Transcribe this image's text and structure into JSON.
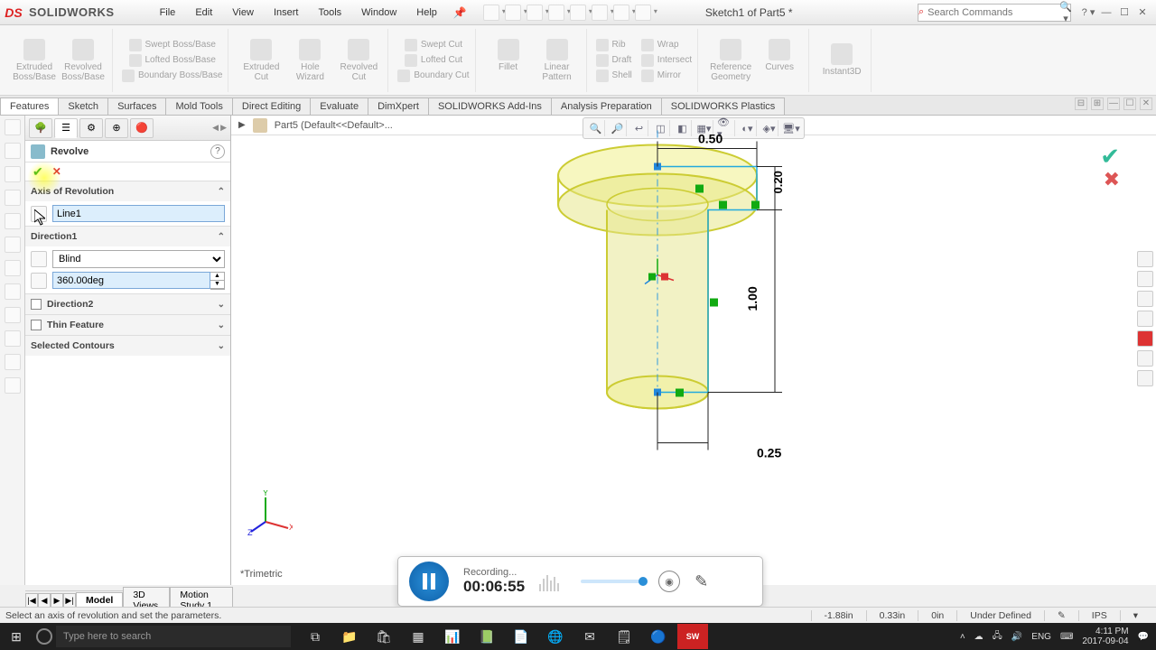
{
  "brand": {
    "prefix": "S",
    "name": "SOLID",
    "suffix": "WORKS"
  },
  "menu": [
    "File",
    "Edit",
    "View",
    "Insert",
    "Tools",
    "Window",
    "Help"
  ],
  "doctitle": "Sketch1 of Part5 *",
  "search": {
    "placeholder": "Search Commands"
  },
  "ribbon": {
    "big": [
      {
        "l1": "Extruded",
        "l2": "Boss/Base"
      },
      {
        "l1": "Revolved",
        "l2": "Boss/Base"
      }
    ],
    "boss_small": [
      "Swept Boss/Base",
      "Lofted Boss/Base",
      "Boundary Boss/Base"
    ],
    "cut_big": [
      {
        "l1": "Extruded",
        "l2": "Cut"
      },
      {
        "l1": "Hole",
        "l2": "Wizard"
      },
      {
        "l1": "Revolved",
        "l2": "Cut"
      }
    ],
    "cut_small": [
      "Swept Cut",
      "Lofted Cut",
      "Boundary Cut"
    ],
    "feat_big": [
      {
        "l1": "Fillet",
        "l2": ""
      },
      {
        "l1": "Linear",
        "l2": "Pattern"
      }
    ],
    "feat_small": [
      "Rib",
      "Draft",
      "Shell",
      "Wrap",
      "Intersect",
      "Mirror"
    ],
    "ref": [
      {
        "l1": "Reference",
        "l2": "Geometry"
      },
      {
        "l1": "Curves",
        "l2": ""
      }
    ],
    "instant": "Instant3D"
  },
  "cmdtabs": [
    "Features",
    "Sketch",
    "Surfaces",
    "Mold Tools",
    "Direct Editing",
    "Evaluate",
    "DimXpert",
    "SOLIDWORKS Add-Ins",
    "Analysis Preparation",
    "SOLIDWORKS Plastics"
  ],
  "breadcrumb": "Part5  (Default<<Default>...",
  "pm": {
    "title": "Revolve",
    "sections": {
      "axis": {
        "label": "Axis of Revolution",
        "value": "Line1"
      },
      "dir1": {
        "label": "Direction1",
        "type": "Blind",
        "angle": "360.00deg"
      },
      "dir2": {
        "label": "Direction2"
      },
      "thin": {
        "label": "Thin Feature"
      },
      "contours": {
        "label": "Selected Contours"
      }
    }
  },
  "dims": {
    "top": "0.50",
    "right_top": "0.20",
    "right": "1.00",
    "bottom": "0.25"
  },
  "viewname": "*Trimetric",
  "bottomtabs": [
    "Model",
    "3D Views",
    "Motion Study 1"
  ],
  "status": {
    "msg": "Select an axis of revolution and set the parameters.",
    "x": "-1.88in",
    "y": "0.33in",
    "z": "0in",
    "state": "Under Defined",
    "units": "IPS"
  },
  "recorder": {
    "label": "Recording...",
    "time": "00:06:55"
  },
  "taskbar": {
    "search": "Type here to search",
    "lang": "ENG",
    "time": "4:11 PM",
    "date": "2017-09-04"
  }
}
